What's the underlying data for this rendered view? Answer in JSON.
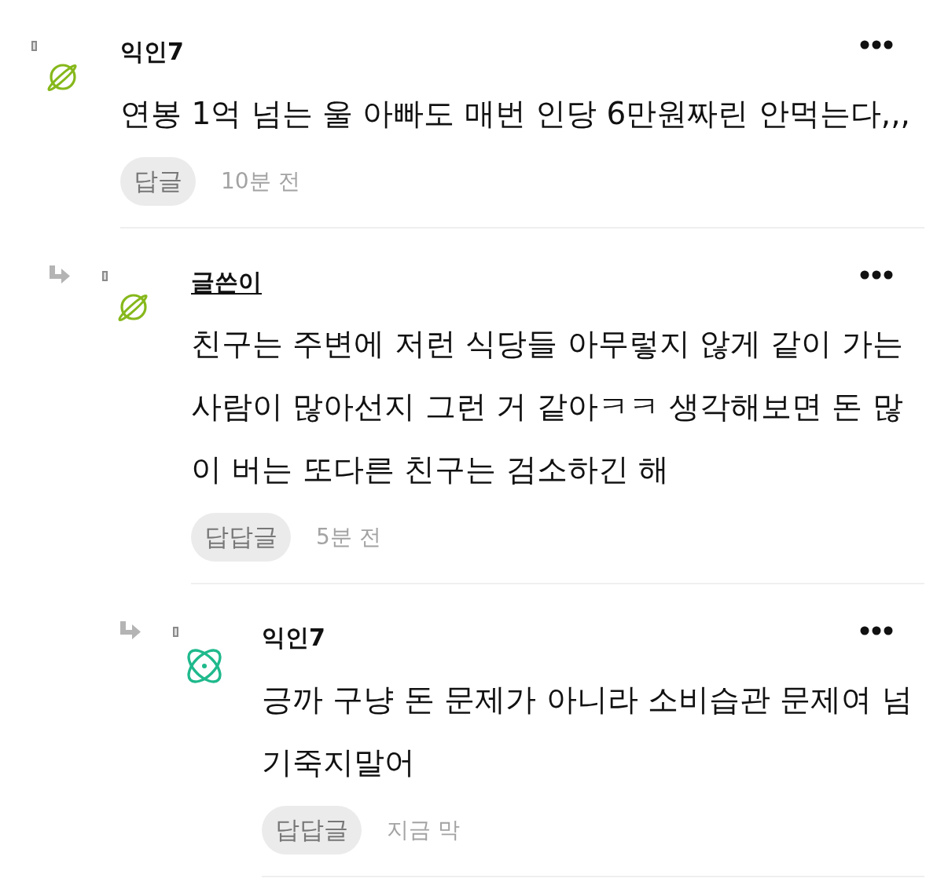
{
  "comments": [
    {
      "author": "익인7",
      "is_writer": false,
      "avatar": {
        "kind": "planet",
        "color": "#86b81b"
      },
      "body": "연봉 1억 넘는 울 아빠도 매번 인당 6만원짜린 안먹는다,,,",
      "reply_button": "답글",
      "time": "10분 전",
      "children": [
        {
          "author": "글쓴이",
          "is_writer": true,
          "avatar": {
            "kind": "planet",
            "color": "#86b81b"
          },
          "body": "친구는 주변에 저런 식당들 아무렇지 않게 같이 가는 사람이 많아선지 그런 거 같아ㅋㅋ 생각해보면 돈 많이 버는 또다른 친구는 검소하긴 해",
          "reply_button": "답답글",
          "time": "5분 전",
          "children": [
            {
              "author": "익인7",
              "is_writer": false,
              "avatar": {
                "kind": "atom",
                "color": "#1fb98c"
              },
              "body": "긍까 구냥 돈 문제가 아니라 소비습관 문제여 넘 기죽지말어",
              "reply_button": "답답글",
              "time": "지금 막"
            }
          ]
        }
      ]
    }
  ]
}
